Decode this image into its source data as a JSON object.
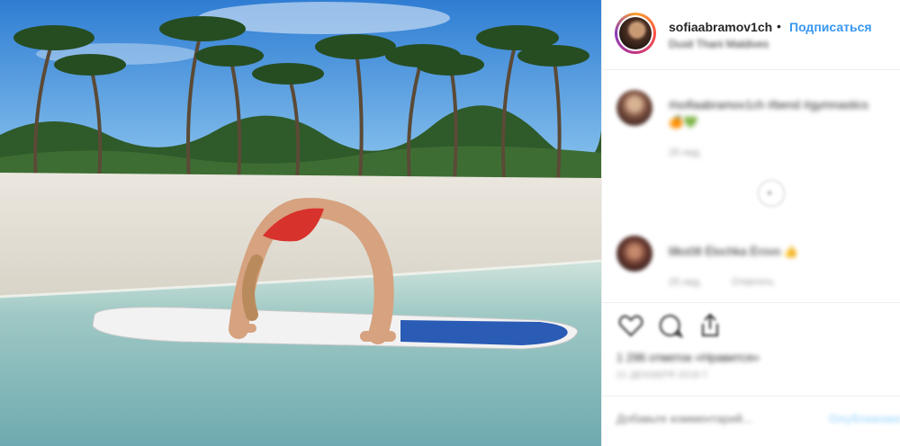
{
  "post": {
    "username": "sofiaabramov1ch",
    "separator": "•",
    "follow_label": "Подписаться",
    "location": "Dusit Thani Maldives"
  },
  "comments": [
    {
      "username": "sofiaabramov1ch",
      "text": "#sofiaabramov1ch #bend #gymnastics",
      "emoji": "🍊💚",
      "time": "25 нед."
    },
    {
      "username": "lilko08",
      "text": "lilko08 Ёlochka Ёrovo 👍",
      "time": "25 нед.",
      "reply": "Ответить"
    }
  ],
  "actions": {
    "likes_text": "1 296 отметок «Нравится»",
    "date": "21 ДЕКАБРЯ 2018 Г."
  },
  "add_comment": {
    "placeholder": "Добавьте комментарий...",
    "post_label": "Опубликовать"
  },
  "icons": [
    "heart-icon",
    "comment-icon",
    "share-icon"
  ],
  "colors": {
    "accent": "#3897f0",
    "text": "#262626",
    "muted": "#999999"
  }
}
